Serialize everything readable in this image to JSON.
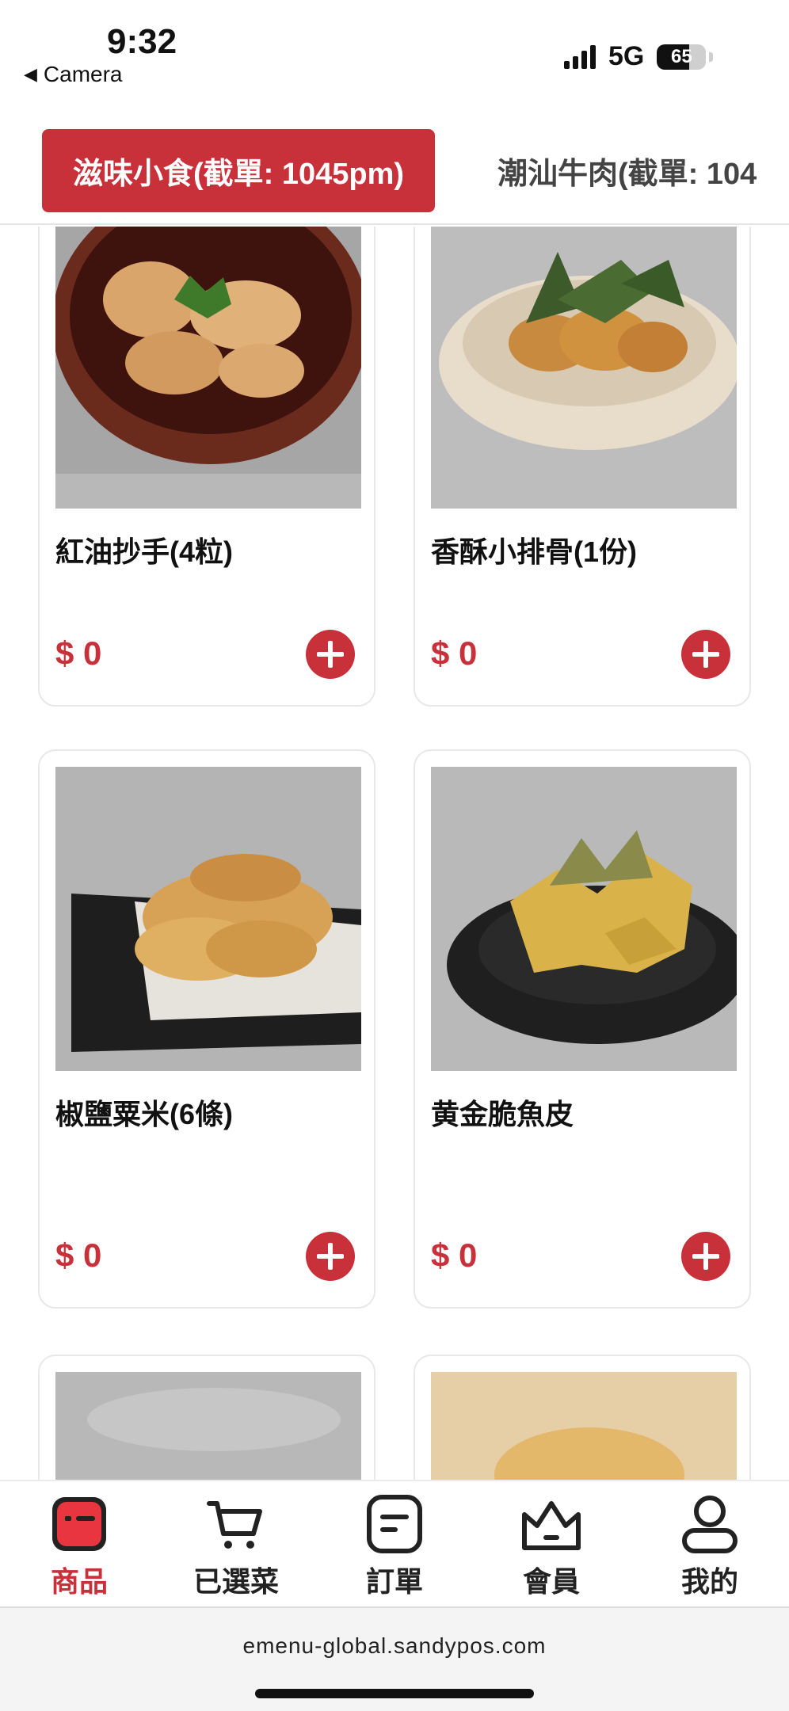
{
  "status_bar": {
    "time": "9:32",
    "back_label": "Camera",
    "network": "5G",
    "battery": "65"
  },
  "tabs": [
    {
      "label": "滋味小食(截單: 1045pm)",
      "active": true
    },
    {
      "label": "潮汕牛肉(截單: 104",
      "active": false
    }
  ],
  "products": [
    {
      "name": "紅油抄手(4粒)",
      "price": "$ 0"
    },
    {
      "name": "香酥小排骨(1份)",
      "price": "$ 0"
    },
    {
      "name": "椒鹽粟米(6條)",
      "price": "$ 0"
    },
    {
      "name": "黄金脆魚皮",
      "price": "$ 0"
    },
    {
      "name": "",
      "price": ""
    },
    {
      "name": "",
      "price": ""
    }
  ],
  "bottom_nav": [
    {
      "label": "商品",
      "icon": "menu-box-icon",
      "active": true
    },
    {
      "label": "已選菜",
      "icon": "cart-icon",
      "active": false
    },
    {
      "label": "訂單",
      "icon": "order-icon",
      "active": false
    },
    {
      "label": "會員",
      "icon": "crown-icon",
      "active": false
    },
    {
      "label": "我的",
      "icon": "user-icon",
      "active": false
    }
  ],
  "url": "emenu-global.sandypos.com",
  "colors": {
    "accent": "#c8313a",
    "text": "#1a1a1a"
  }
}
